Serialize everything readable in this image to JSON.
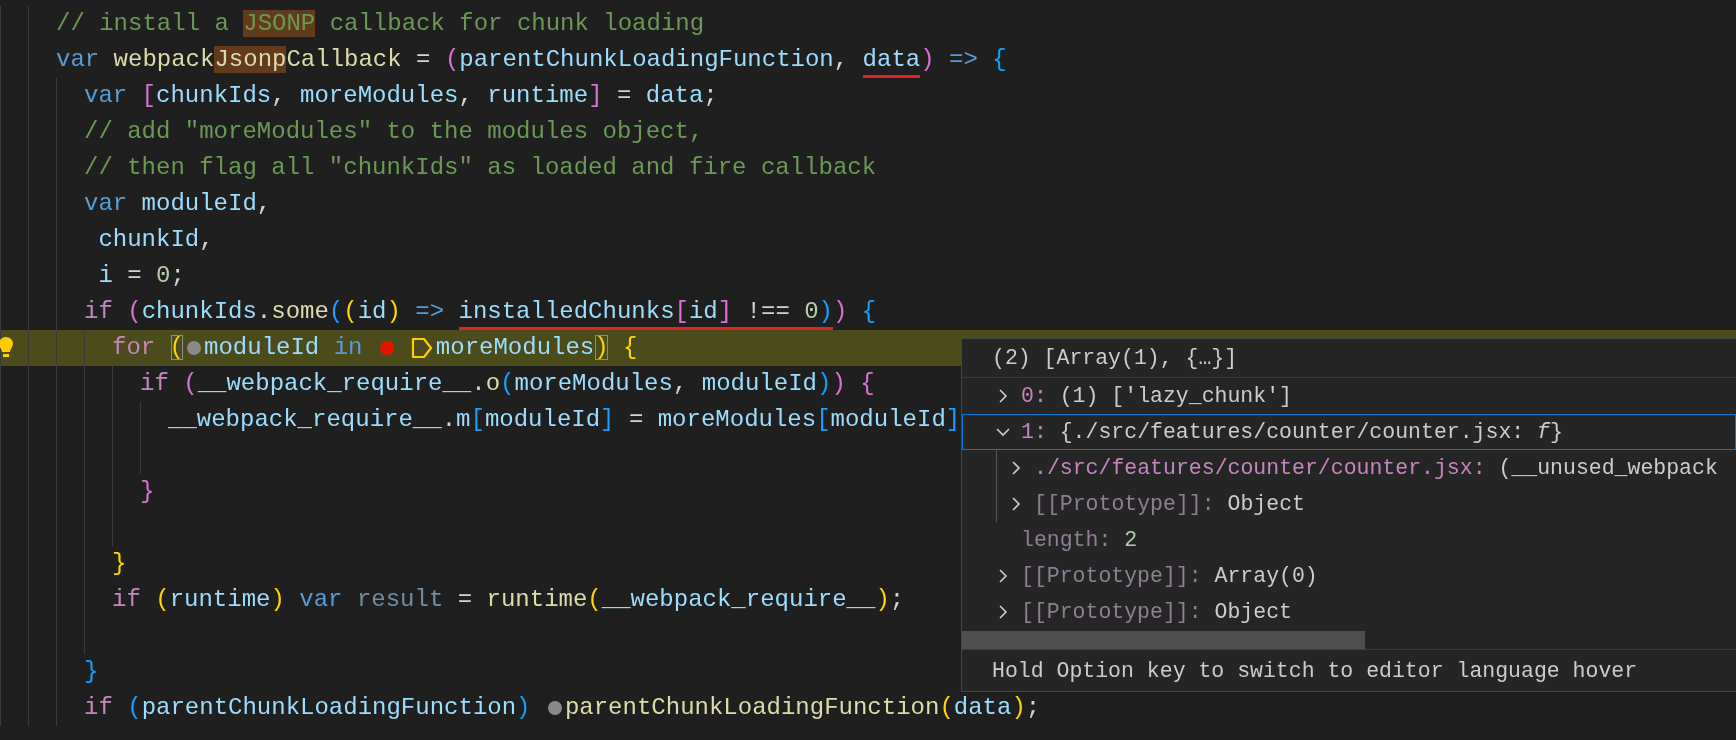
{
  "editor": {
    "lines": [
      {
        "kind": "code",
        "current": false,
        "lightbulb": false,
        "tokens": [
          {
            "text": "// install a ",
            "kind": "comment"
          },
          {
            "text": "JSONP",
            "kind": "comment",
            "match": true
          },
          {
            "text": " callback for chunk loading",
            "kind": "comment"
          }
        ]
      },
      {
        "kind": "code",
        "current": false,
        "lightbulb": false,
        "tokens": [
          {
            "text": "var ",
            "kind": "keyword"
          },
          {
            "text": "webpack",
            "kind": "function"
          },
          {
            "text": "Jsonp",
            "kind": "function",
            "match": true
          },
          {
            "text": "Callback",
            "kind": "function"
          },
          {
            "text": " = ",
            "kind": "plain"
          },
          {
            "text": "(",
            "kind": "bracket2"
          },
          {
            "text": "parentChunkLoadingFunction",
            "kind": "variable"
          },
          {
            "text": ", ",
            "kind": "plain"
          },
          {
            "text": "data",
            "kind": "variable",
            "underlined": true
          },
          {
            "text": ")",
            "kind": "bracket2"
          },
          {
            "text": " => ",
            "kind": "keyword"
          },
          {
            "text": "{",
            "kind": "bracket3"
          }
        ],
        "children": [
          {
            "kind": "code",
            "current": false,
            "lightbulb": false,
            "tokens": [
              {
                "text": "var ",
                "kind": "keyword"
              },
              {
                "text": "[",
                "kind": "bracket2"
              },
              {
                "text": "chunkIds",
                "kind": "variable"
              },
              {
                "text": ", ",
                "kind": "plain"
              },
              {
                "text": "moreModules",
                "kind": "variable"
              },
              {
                "text": ", ",
                "kind": "plain"
              },
              {
                "text": "runtime",
                "kind": "variable"
              },
              {
                "text": "]",
                "kind": "bracket2"
              },
              {
                "text": " = ",
                "kind": "plain"
              },
              {
                "text": "data",
                "kind": "variable"
              },
              {
                "text": ";",
                "kind": "plain"
              }
            ]
          },
          {
            "kind": "code",
            "current": false,
            "lightbulb": false,
            "tokens": [
              {
                "text": "// add \"moreModules\" to the modules object,",
                "kind": "comment"
              }
            ]
          },
          {
            "kind": "code",
            "current": false,
            "lightbulb": false,
            "tokens": [
              {
                "text": "// then flag all \"chunkIds\" as loaded and fire callback",
                "kind": "comment"
              }
            ]
          },
          {
            "kind": "code",
            "current": false,
            "lightbulb": false,
            "tokens": [
              {
                "text": "var ",
                "kind": "keyword"
              },
              {
                "text": "moduleId",
                "kind": "variable"
              },
              {
                "text": ",",
                "kind": "plain"
              }
            ]
          },
          {
            "kind": "code",
            "current": false,
            "lightbulb": false,
            "tokens": [
              {
                "text": " chunkId",
                "kind": "variable"
              },
              {
                "text": ",",
                "kind": "plain"
              }
            ]
          },
          {
            "kind": "code",
            "current": false,
            "lightbulb": false,
            "tokens": [
              {
                "text": " i",
                "kind": "variable"
              },
              {
                "text": " = ",
                "kind": "plain"
              },
              {
                "text": "0",
                "kind": "number"
              },
              {
                "text": ";",
                "kind": "plain"
              }
            ]
          },
          {
            "kind": "code",
            "current": false,
            "lightbulb": false,
            "tokens": [
              {
                "text": "if ",
                "kind": "control"
              },
              {
                "text": "(",
                "kind": "bracket2"
              },
              {
                "text": "chunkIds",
                "kind": "variable"
              },
              {
                "text": ".",
                "kind": "plain"
              },
              {
                "text": "some",
                "kind": "function"
              },
              {
                "text": "(",
                "kind": "bracket3"
              },
              {
                "text": "(",
                "kind": "bracket1"
              },
              {
                "text": "id",
                "kind": "variable"
              },
              {
                "text": ")",
                "kind": "bracket1"
              },
              {
                "text": " => ",
                "kind": "keyword"
              },
              {
                "text": "installedChunks",
                "kind": "variable",
                "underlined": true
              },
              {
                "text": "[",
                "kind": "bracket2",
                "underlined": true
              },
              {
                "text": "id",
                "kind": "variable",
                "underlined": true
              },
              {
                "text": "]",
                "kind": "bracket2",
                "underlined": true
              },
              {
                "text": " !== ",
                "kind": "plain",
                "underlined": true
              },
              {
                "text": "0",
                "kind": "number",
                "underlined": true
              },
              {
                "text": ")",
                "kind": "bracket3",
                "underlined": true
              },
              {
                "text": ")",
                "kind": "bracket2"
              },
              {
                "text": " {",
                "kind": "bracket3"
              }
            ],
            "children": [
              {
                "kind": "code",
                "current": true,
                "lightbulb": true,
                "tokens": [
                  {
                    "text": "for ",
                    "kind": "control"
                  },
                  {
                    "text": "(",
                    "kind": "bracket1",
                    "boxed": true
                  },
                  {
                    "kind": "hint-dot"
                  },
                  {
                    "text": "moduleId",
                    "kind": "variable"
                  },
                  {
                    "text": " in ",
                    "kind": "keyword"
                  },
                  {
                    "kind": "breakpoint"
                  },
                  {
                    "kind": "pointer"
                  },
                  {
                    "text": "moreModules",
                    "kind": "variable"
                  },
                  {
                    "text": ")",
                    "kind": "bracket1",
                    "boxed": true
                  },
                  {
                    "text": " {",
                    "kind": "bracket1"
                  }
                ],
                "children": [
                  {
                    "kind": "code",
                    "current": false,
                    "lightbulb": false,
                    "tokens": [
                      {
                        "text": "if ",
                        "kind": "control"
                      },
                      {
                        "text": "(",
                        "kind": "bracket2"
                      },
                      {
                        "text": "__webpack_require__",
                        "kind": "variable"
                      },
                      {
                        "text": ".",
                        "kind": "plain"
                      },
                      {
                        "text": "o",
                        "kind": "function"
                      },
                      {
                        "text": "(",
                        "kind": "bracket3"
                      },
                      {
                        "text": "moreModules",
                        "kind": "variable"
                      },
                      {
                        "text": ", ",
                        "kind": "plain"
                      },
                      {
                        "text": "moduleId",
                        "kind": "variable"
                      },
                      {
                        "text": ")",
                        "kind": "bracket3"
                      },
                      {
                        "text": ")",
                        "kind": "bracket2"
                      },
                      {
                        "text": " {",
                        "kind": "bracket2"
                      }
                    ],
                    "children": [
                      {
                        "kind": "code",
                        "current": false,
                        "lightbulb": false,
                        "tokens": [
                          {
                            "text": "__webpack_require__",
                            "kind": "variable"
                          },
                          {
                            "text": ".",
                            "kind": "plain"
                          },
                          {
                            "text": "m",
                            "kind": "variable"
                          },
                          {
                            "text": "[",
                            "kind": "bracket3"
                          },
                          {
                            "text": "moduleId",
                            "kind": "variable"
                          },
                          {
                            "text": "]",
                            "kind": "bracket3"
                          },
                          {
                            "text": " = ",
                            "kind": "plain"
                          },
                          {
                            "text": "moreModules",
                            "kind": "variable"
                          },
                          {
                            "text": "[",
                            "kind": "bracket3"
                          },
                          {
                            "text": "moduleId",
                            "kind": "variable"
                          },
                          {
                            "text": "]",
                            "kind": "bracket3"
                          }
                        ]
                      },
                      {
                        "kind": "blank"
                      }
                    ]
                  },
                  {
                    "kind": "code",
                    "current": false,
                    "lightbulb": false,
                    "tokens": [
                      {
                        "text": "}",
                        "kind": "bracket2"
                      }
                    ]
                  },
                  {
                    "kind": "blank"
                  }
                ]
              },
              {
                "kind": "code",
                "current": false,
                "lightbulb": false,
                "tokens": [
                  {
                    "text": "}",
                    "kind": "bracket1"
                  }
                ]
              },
              {
                "kind": "code",
                "current": false,
                "lightbulb": false,
                "tokens": [
                  {
                    "text": "if ",
                    "kind": "control"
                  },
                  {
                    "text": "(",
                    "kind": "bracket1"
                  },
                  {
                    "text": "runtime",
                    "kind": "variable"
                  },
                  {
                    "text": ")",
                    "kind": "bracket1"
                  },
                  {
                    "text": " var ",
                    "kind": "keyword"
                  },
                  {
                    "text": "result",
                    "kind": "unused"
                  },
                  {
                    "text": " = ",
                    "kind": "plain"
                  },
                  {
                    "text": "runtime",
                    "kind": "function"
                  },
                  {
                    "text": "(",
                    "kind": "bracket1"
                  },
                  {
                    "text": "__webpack_require__",
                    "kind": "variable"
                  },
                  {
                    "text": ")",
                    "kind": "bracket1"
                  },
                  {
                    "text": ";",
                    "kind": "plain"
                  }
                ]
              },
              {
                "kind": "blank"
              }
            ]
          },
          {
            "kind": "code",
            "current": false,
            "lightbulb": false,
            "tokens": [
              {
                "text": "}",
                "kind": "bracket3"
              }
            ]
          },
          {
            "kind": "code",
            "current": false,
            "lightbulb": false,
            "tokens": [
              {
                "text": "if ",
                "kind": "control"
              },
              {
                "text": "(",
                "kind": "bracket3"
              },
              {
                "text": "parentChunkLoadingFunction",
                "kind": "variable"
              },
              {
                "text": ") ",
                "kind": "bracket3"
              },
              {
                "kind": "hint-dot"
              },
              {
                "text": "parentChunkLoadingFunction",
                "kind": "function"
              },
              {
                "text": "(",
                "kind": "bracket1"
              },
              {
                "text": "data",
                "kind": "variable"
              },
              {
                "text": ")",
                "kind": "bracket1"
              },
              {
                "text": ";",
                "kind": "plain"
              }
            ]
          }
        ]
      }
    ]
  },
  "hover": {
    "header": "(2) [Array(1), {…}]",
    "items": [
      {
        "kind": "property",
        "key": "0:",
        "value": "(1) ['lazy_chunk']",
        "expanded": false,
        "selected": false
      },
      {
        "kind": "property",
        "key": "1:",
        "value": "{./src/features/counter/counter.jsx: *f*}",
        "expanded": true,
        "selected": true,
        "children": [
          {
            "kind": "property",
            "key": "./src/features/counter/counter.jsx:",
            "value": "(__unused_webpack",
            "expanded": false,
            "selected": false
          },
          {
            "kind": "internal",
            "key": "[[Prototype]]:",
            "value": "Object",
            "expanded": false,
            "selected": false
          }
        ]
      },
      {
        "kind": "leaf",
        "key": "length:",
        "value": "2",
        "selected": false
      },
      {
        "kind": "internal",
        "key": "[[Prototype]]:",
        "value": "Array(0)",
        "expanded": false,
        "selected": false
      },
      {
        "kind": "internal",
        "key": "[[Prototype]]:",
        "value": "Object",
        "expanded": false,
        "selected": false
      }
    ],
    "footer": "Hold Option key to switch to editor language hover"
  }
}
